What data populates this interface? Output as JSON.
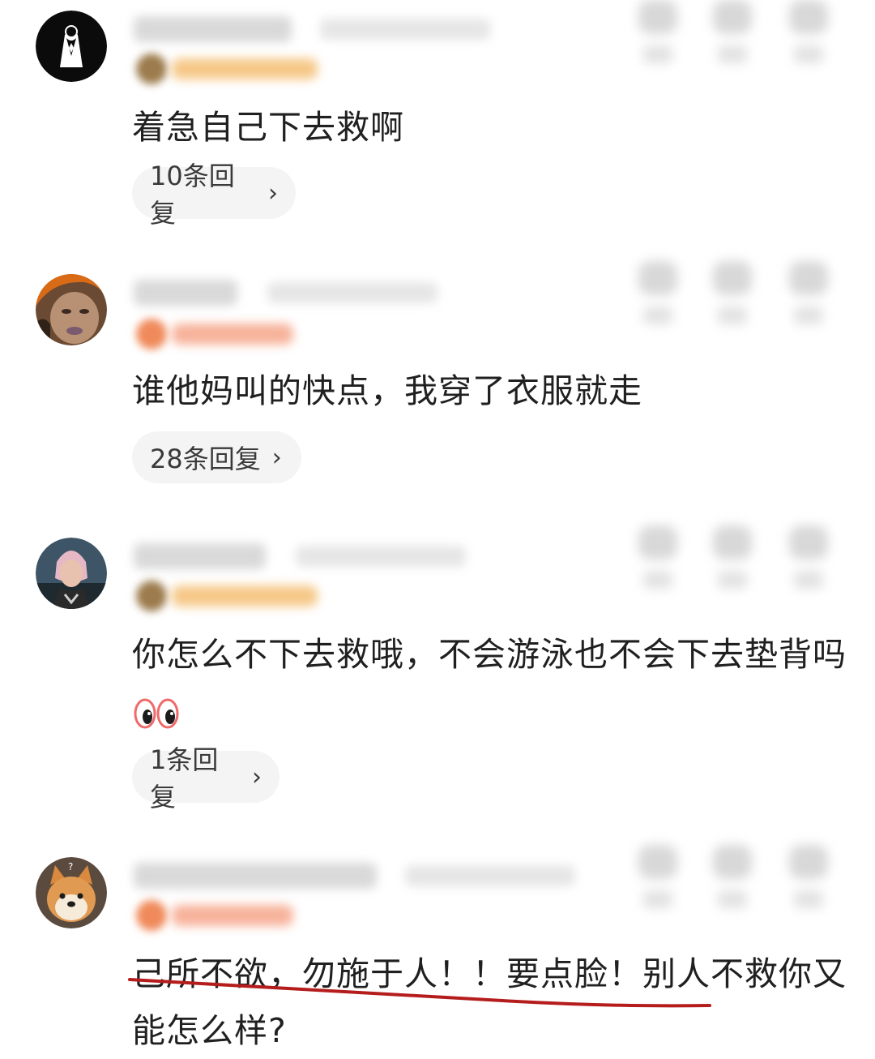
{
  "comments": [
    {
      "text": "着急自己下去救啊",
      "reply_label": "10条回复",
      "avatar_icon": "tuxedo-man-avatar"
    },
    {
      "text": "谁他妈叫的快点，我穿了衣服就走",
      "reply_label": "28条回复",
      "avatar_icon": "man-face-photo-avatar"
    },
    {
      "text": "你怎么不下去救哦，不会游泳也不会下去垫背吗",
      "reply_label": "1条回复",
      "avatar_icon": "game-character-avatar",
      "emoji": "eyes-emoji"
    },
    {
      "text": "己所不欲，勿施于人！！要点脸！别人不救你又能怎么样?",
      "avatar_icon": "shiba-dog-avatar",
      "underline_color": "#b51d1d"
    }
  ],
  "chevron": "›",
  "colors": {
    "reply_button_bg": "#f4f4f4",
    "text": "#202020",
    "badge_orange": "#f4b27a"
  }
}
